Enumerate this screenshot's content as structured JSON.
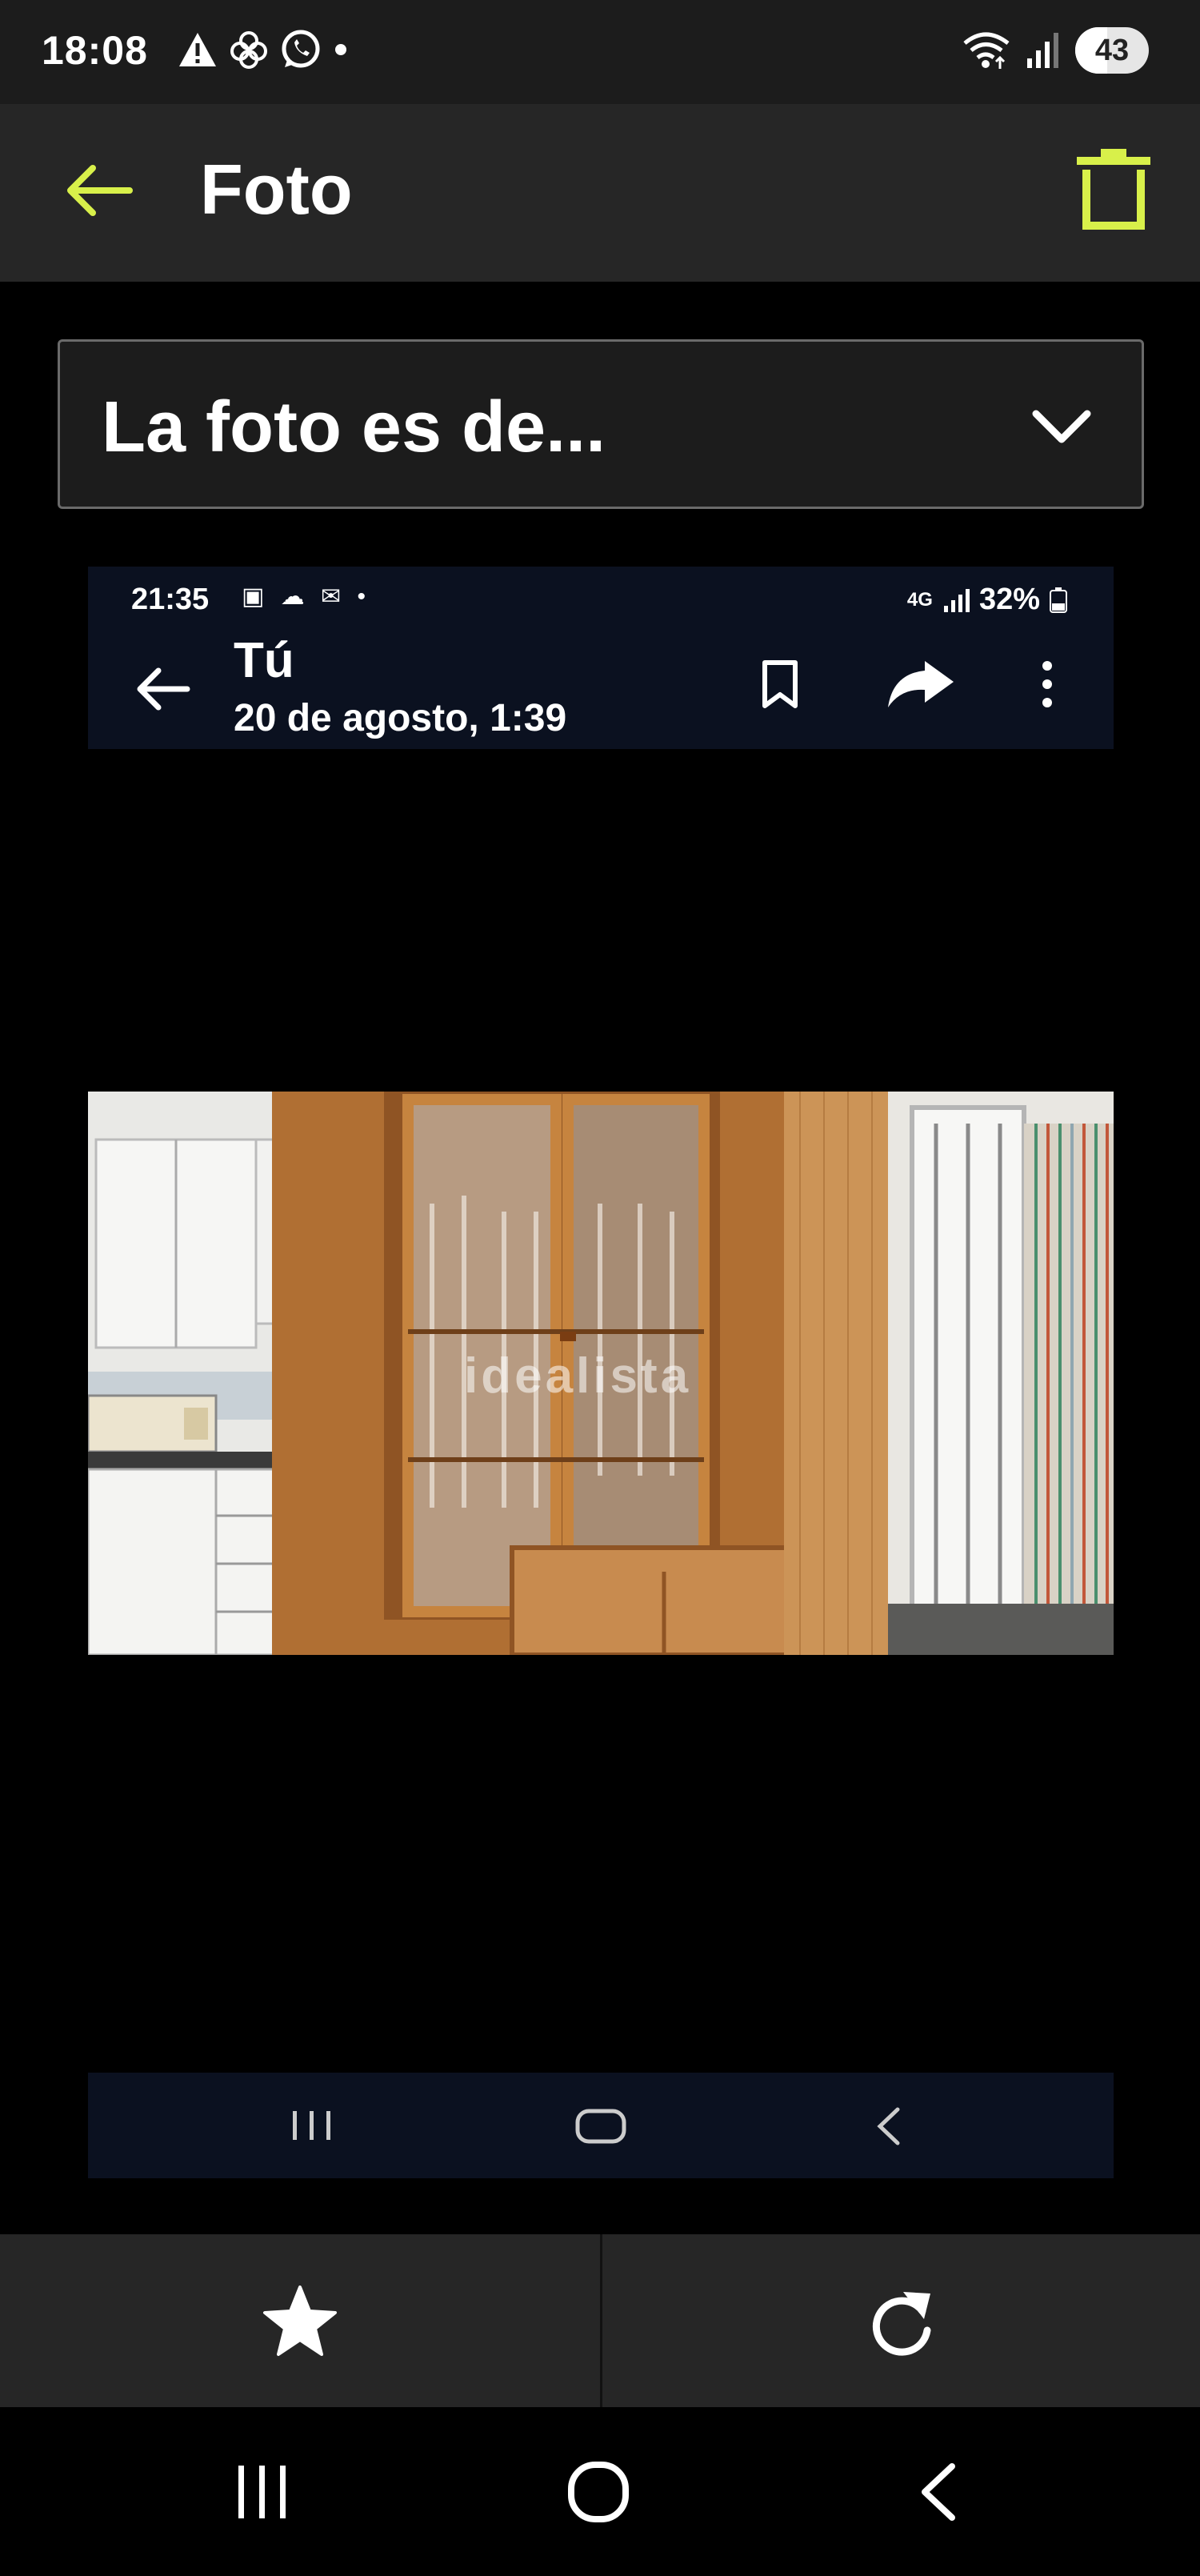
{
  "status_bar": {
    "time": "18:08",
    "battery": "43",
    "battery_level": 0.43
  },
  "app_bar": {
    "title": "Foto",
    "accent_color": "#d8f04a"
  },
  "dropdown": {
    "selected": "La foto es de..."
  },
  "embedded_screenshot": {
    "status_time": "21:35",
    "network": "4G",
    "battery": "32%",
    "sender": "Tú",
    "date": "20 de agosto, 1:39",
    "watermark": "idealista"
  },
  "actions": {
    "favorite_icon": "star-icon",
    "rotate_icon": "rotate-icon"
  },
  "system_nav": {
    "recents_icon": "recents-icon",
    "home_icon": "home-icon",
    "back_icon": "back-icon"
  }
}
